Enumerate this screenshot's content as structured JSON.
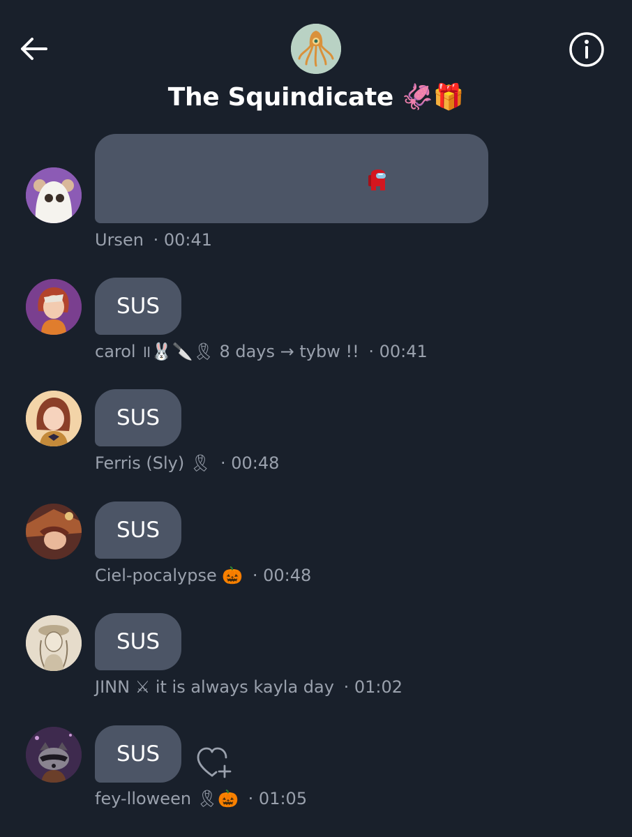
{
  "header": {
    "title": "The Squindicate 🦑🎁"
  },
  "messages": [
    {
      "author": "Ursen",
      "time": "· 00:41",
      "text": ""
    },
    {
      "author": "carol ॥🐰🔪🎗 8 days → tybw !!",
      "time": "· 00:41",
      "text": "SUS"
    },
    {
      "author": "Ferris (Sly) 🎗",
      "time": "· 00:48",
      "text": "SUS"
    },
    {
      "author": "Ciel-pocalypse 🎃",
      "time": "· 00:48",
      "text": "SUS"
    },
    {
      "author": "JINN ⚔ it is always kayla day",
      "time": "· 01:02",
      "text": "SUS"
    },
    {
      "author": "fey-lloween 🎗🎃",
      "time": "· 01:05",
      "text": "SUS"
    }
  ],
  "colors": {
    "background": "#19202b",
    "bubble": "#4c5566",
    "meta_text": "#9aa1ad"
  },
  "icons": {
    "back": "arrow-left-icon",
    "info": "info-icon",
    "react": "heart-plus-icon",
    "sticker": "red-crewmate-icon"
  }
}
